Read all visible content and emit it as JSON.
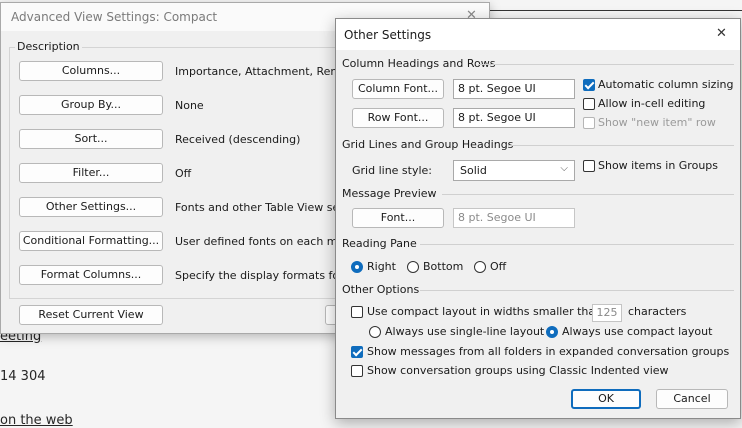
{
  "background": {
    "link_meeting": "eeting",
    "phone_partial": "14 304",
    "link_web": "on the web"
  },
  "back_dialog": {
    "title": "Advanced View Settings: Compact",
    "close_glyph": "✕",
    "description_label": "Description",
    "rows": [
      {
        "button": "Columns...",
        "value": "Importance, Attachment, Remin"
      },
      {
        "button": "Group By...",
        "value": "None"
      },
      {
        "button": "Sort...",
        "value": "Received (descending)"
      },
      {
        "button": "Filter...",
        "value": "Off"
      },
      {
        "button": "Other Settings...",
        "value": "Fonts and other Table View sett"
      },
      {
        "button": "Conditional Formatting...",
        "value": "User defined fonts on each mes"
      },
      {
        "button": "Format Columns...",
        "value": "Specify the display formats for e"
      }
    ],
    "reset_button": "Reset Current View"
  },
  "other_settings": {
    "title": "Other Settings",
    "close_glyph": "✕",
    "column_headings": {
      "header": "Column Headings and Rows",
      "column_font_button": "Column Font...",
      "column_font_value": "8 pt. Segoe UI",
      "row_font_button": "Row Font...",
      "row_font_value": "8 pt. Segoe UI",
      "auto_column_sizing": "Automatic column sizing",
      "auto_column_sizing_checked": true,
      "allow_incell_editing": "Allow in-cell editing",
      "allow_incell_editing_checked": false,
      "show_new_item_row": "Show \"new item\" row",
      "show_new_item_row_checked": false
    },
    "grid_lines": {
      "header": "Grid Lines and Group Headings",
      "grid_line_style_label": "Grid line style:",
      "grid_line_style_value": "Solid",
      "show_items_in_groups": "Show items in Groups",
      "show_items_in_groups_checked": false
    },
    "message_preview": {
      "header": "Message Preview",
      "font_button": "Font...",
      "font_value": "8 pt. Segoe UI"
    },
    "reading_pane": {
      "header": "Reading Pane",
      "options": [
        "Right",
        "Bottom",
        "Off"
      ],
      "selected": "Right"
    },
    "other_options": {
      "header": "Other Options",
      "compact_layout_label": "Use compact layout in widths smaller than",
      "compact_layout_value": "125",
      "compact_layout_suffix": "characters",
      "compact_layout_checked": false,
      "single_line_option": "Always use single-line layout",
      "compact_option": "Always use compact layout",
      "layout_selected": "compact",
      "show_all_folders": "Show messages from all folders in expanded conversation groups",
      "show_all_folders_checked": true,
      "classic_indented": "Show conversation groups using Classic Indented view",
      "classic_indented_checked": false
    },
    "ok_button": "OK",
    "cancel_button": "Cancel"
  },
  "colors": {
    "accent": "#0f6cbd",
    "dialog_bg": "#f0f0f0",
    "link": "#1f4e8c"
  }
}
